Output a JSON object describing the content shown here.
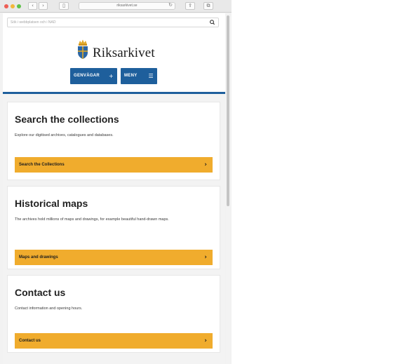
{
  "browser": {
    "url": "riksarkivet.se",
    "back_icon": "chevron-left",
    "forward_icon": "chevron-right",
    "sidebar_icon": "sidebar",
    "reload_icon": "reload",
    "share_icon": "share",
    "tabs_icon": "tabs",
    "traffic_light_colors": [
      "#ee5e55",
      "#f3b83a",
      "#5fc24a"
    ]
  },
  "search": {
    "placeholder": "Sök i webbplatsen och i NAD",
    "icon": "search-icon"
  },
  "site": {
    "logo_text": "Riksarkivet",
    "brand_color": "#1e5f9c",
    "accent_color": "#f0ac2d"
  },
  "nav": {
    "shortcuts_label": "GENVÄGAR",
    "shortcuts_icon": "+",
    "menu_label": "MENY",
    "menu_icon": "☰"
  },
  "cards": [
    {
      "title": "Search the collections",
      "description": "Explore our digitised archives, catalogues and databases.",
      "button_label": "Search the Collections"
    },
    {
      "title": "Historical maps",
      "description": "The archives hold millions of maps and drawings, for example beautiful hand-drawn maps.",
      "button_label": "Maps and drawings"
    },
    {
      "title": "Contact us",
      "description": "Contact information and opening hours.",
      "button_label": "Contact us"
    }
  ],
  "chevron": "›"
}
